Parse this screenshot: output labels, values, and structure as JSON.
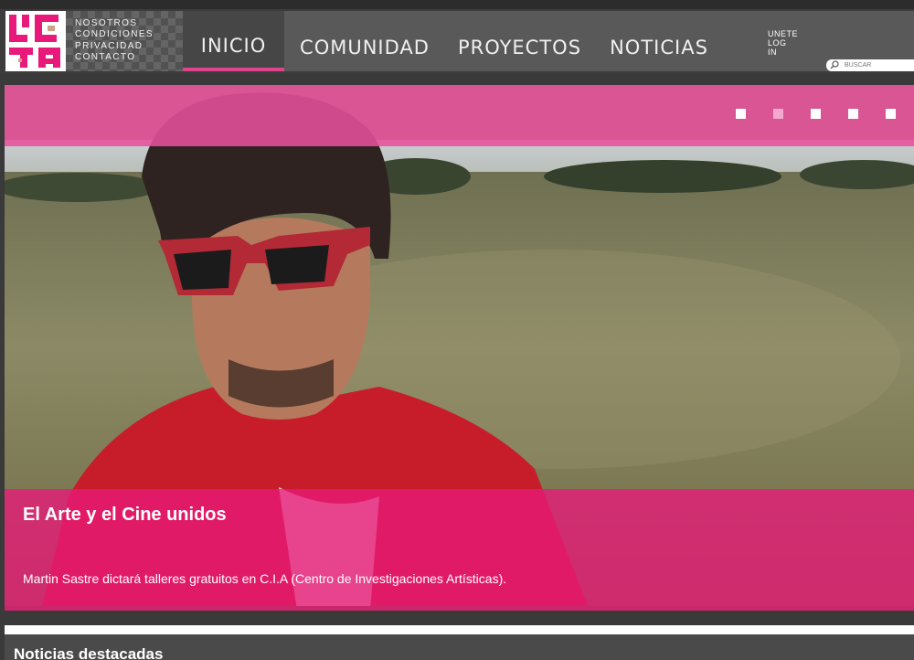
{
  "header": {
    "logo_alt": "UCA",
    "footer_links": [
      "NOSOTROS",
      "CONDICIONES",
      "PRIVACIDAD",
      "CONTACTO"
    ]
  },
  "nav": {
    "items": [
      {
        "label": "INICIO",
        "active": true
      },
      {
        "label": "COMUNIDAD",
        "active": false
      },
      {
        "label": "PROYECTOS",
        "active": false
      },
      {
        "label": "NOTICIAS",
        "active": false
      }
    ]
  },
  "account": {
    "join_label": "UNETE",
    "login_label": "LOG IN"
  },
  "search": {
    "placeholder": "BUSCAR",
    "icon": "search-icon"
  },
  "slider": {
    "active_index": 1,
    "dot_count": 5,
    "title": "El Arte y el Cine unidos",
    "description": "Martin Sastre dictará talleres gratuitos en C.I.A (Centro de Investigaciones Artísticas)."
  },
  "sections": {
    "featured_title": "Noticias destacadas"
  },
  "colors": {
    "accent_pink": "#e0448c",
    "nav_bg": "#595959",
    "page_bg": "#3a3a3a"
  }
}
